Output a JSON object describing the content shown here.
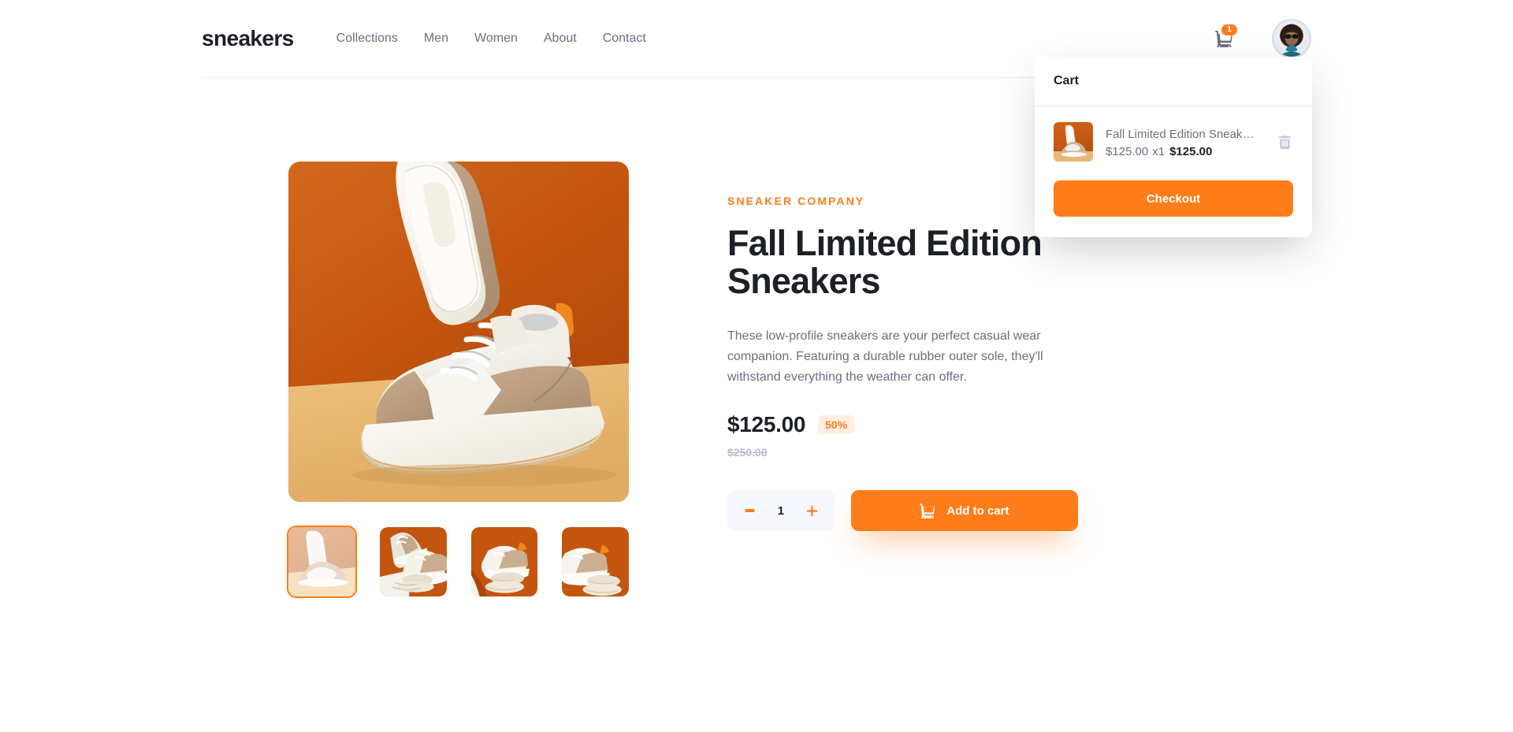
{
  "header": {
    "logo": "sneakers",
    "nav": [
      {
        "label": "Collections"
      },
      {
        "label": "Men"
      },
      {
        "label": "Women"
      },
      {
        "label": "About"
      },
      {
        "label": "Contact"
      }
    ],
    "cart_icon": "cart-icon",
    "cart_badge_count": "1",
    "avatar_icon": "user-avatar"
  },
  "cart_panel": {
    "title": "Cart",
    "items": [
      {
        "name": "Fall Limited Edition Sneakers",
        "unit_price": "$125.00",
        "quantity": "x1",
        "line_total": "$125.00",
        "delete_icon": "trash-icon"
      }
    ],
    "checkout_label": "Checkout"
  },
  "gallery": {
    "selected_index": 0,
    "thumbnails": [
      {
        "alt": "product-thumbnail-1"
      },
      {
        "alt": "product-thumbnail-2"
      },
      {
        "alt": "product-thumbnail-3"
      },
      {
        "alt": "product-thumbnail-4"
      }
    ]
  },
  "product": {
    "brand": "Sneaker Company",
    "title": "Fall Limited Edition Sneakers",
    "description": "These low-profile sneakers are your perfect casual wear companion. Featuring a durable rubber outer sole, they'll withstand everything the weather can offer.",
    "price_current": "$125.00",
    "discount": "50%",
    "price_original": "$250.00",
    "quantity": "1",
    "minus_label": "−",
    "plus_label": "+",
    "add_to_cart_label": "Add to cart",
    "cart_icon": "cart-icon"
  },
  "colors": {
    "accent": "#ff7d1a",
    "accent_pale": "#ffeee2",
    "text_dark": "#1d2026",
    "text_muted": "#68707d",
    "text_faded": "#b6bcc8",
    "divider": "#e4e9f2",
    "stepper_bg": "#f7f8fd"
  }
}
